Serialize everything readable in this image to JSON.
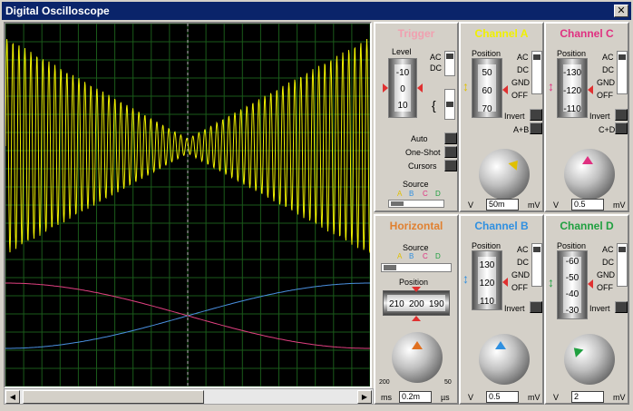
{
  "window": {
    "title": "Digital Oscilloscope",
    "close": "✕"
  },
  "trigger": {
    "title": "Trigger",
    "title_color": "#f0a0b0",
    "level_label": "Level",
    "level_ticks": [
      "-10",
      "0",
      "10"
    ],
    "ac": "AC",
    "dc": "DC",
    "auto": "Auto",
    "oneshot": "One-Shot",
    "cursors": "Cursors",
    "source_label": "Source",
    "sources": [
      "A",
      "B",
      "C",
      "D"
    ]
  },
  "horizontal": {
    "title": "Horizontal",
    "title_color": "#e08030",
    "source_label": "Source",
    "sources": [
      "A",
      "B",
      "C",
      "D"
    ],
    "position_label": "Position",
    "position_ticks": [
      "210",
      "200",
      "190"
    ],
    "unit_left": "ms",
    "unit_right": "µs",
    "value": "0.2m",
    "dial_low": "200",
    "dial_high": "50"
  },
  "channel_a": {
    "title": "Channel A",
    "title_color": "#f0f000",
    "position_label": "Position",
    "ticks": [
      "50",
      "60",
      "70"
    ],
    "coupling": [
      "AC",
      "DC",
      "GND",
      "OFF"
    ],
    "invert": "Invert",
    "combine": "A+B",
    "unit_left": "V",
    "unit_right": "mV",
    "value": "50m"
  },
  "channel_b": {
    "title": "Channel B",
    "title_color": "#3090e0",
    "position_label": "Position",
    "ticks": [
      "130",
      "120",
      "110"
    ],
    "coupling": [
      "AC",
      "DC",
      "GND",
      "OFF"
    ],
    "invert": "Invert",
    "unit_left": "V",
    "unit_right": "mV",
    "value": "0.5"
  },
  "channel_c": {
    "title": "Channel C",
    "title_color": "#e03080",
    "position_label": "Position",
    "ticks": [
      "-130",
      "-120",
      "-110"
    ],
    "coupling": [
      "AC",
      "DC",
      "GND",
      "OFF"
    ],
    "invert": "Invert",
    "combine": "C+D",
    "unit_left": "V",
    "unit_right": "mV",
    "value": "0.5"
  },
  "channel_d": {
    "title": "Channel D",
    "title_color": "#20a040",
    "position_label": "Position",
    "ticks": [
      "-60",
      "-50",
      "-40",
      "-30"
    ],
    "coupling": [
      "AC",
      "DC",
      "GND",
      "OFF"
    ],
    "invert": "Invert",
    "unit_left": "V",
    "unit_right": "mV",
    "value": "2"
  },
  "dial_scale": [
    "0.5",
    "1",
    "2",
    "5",
    "10",
    "20",
    "50",
    "0.2",
    "0.1",
    "20",
    "10",
    "5",
    "2"
  ],
  "traces": {
    "a_color": "#f0f000",
    "b_color": "#4a90e0",
    "c_color": "#e04080",
    "grid_color": "#1a5a1a"
  }
}
